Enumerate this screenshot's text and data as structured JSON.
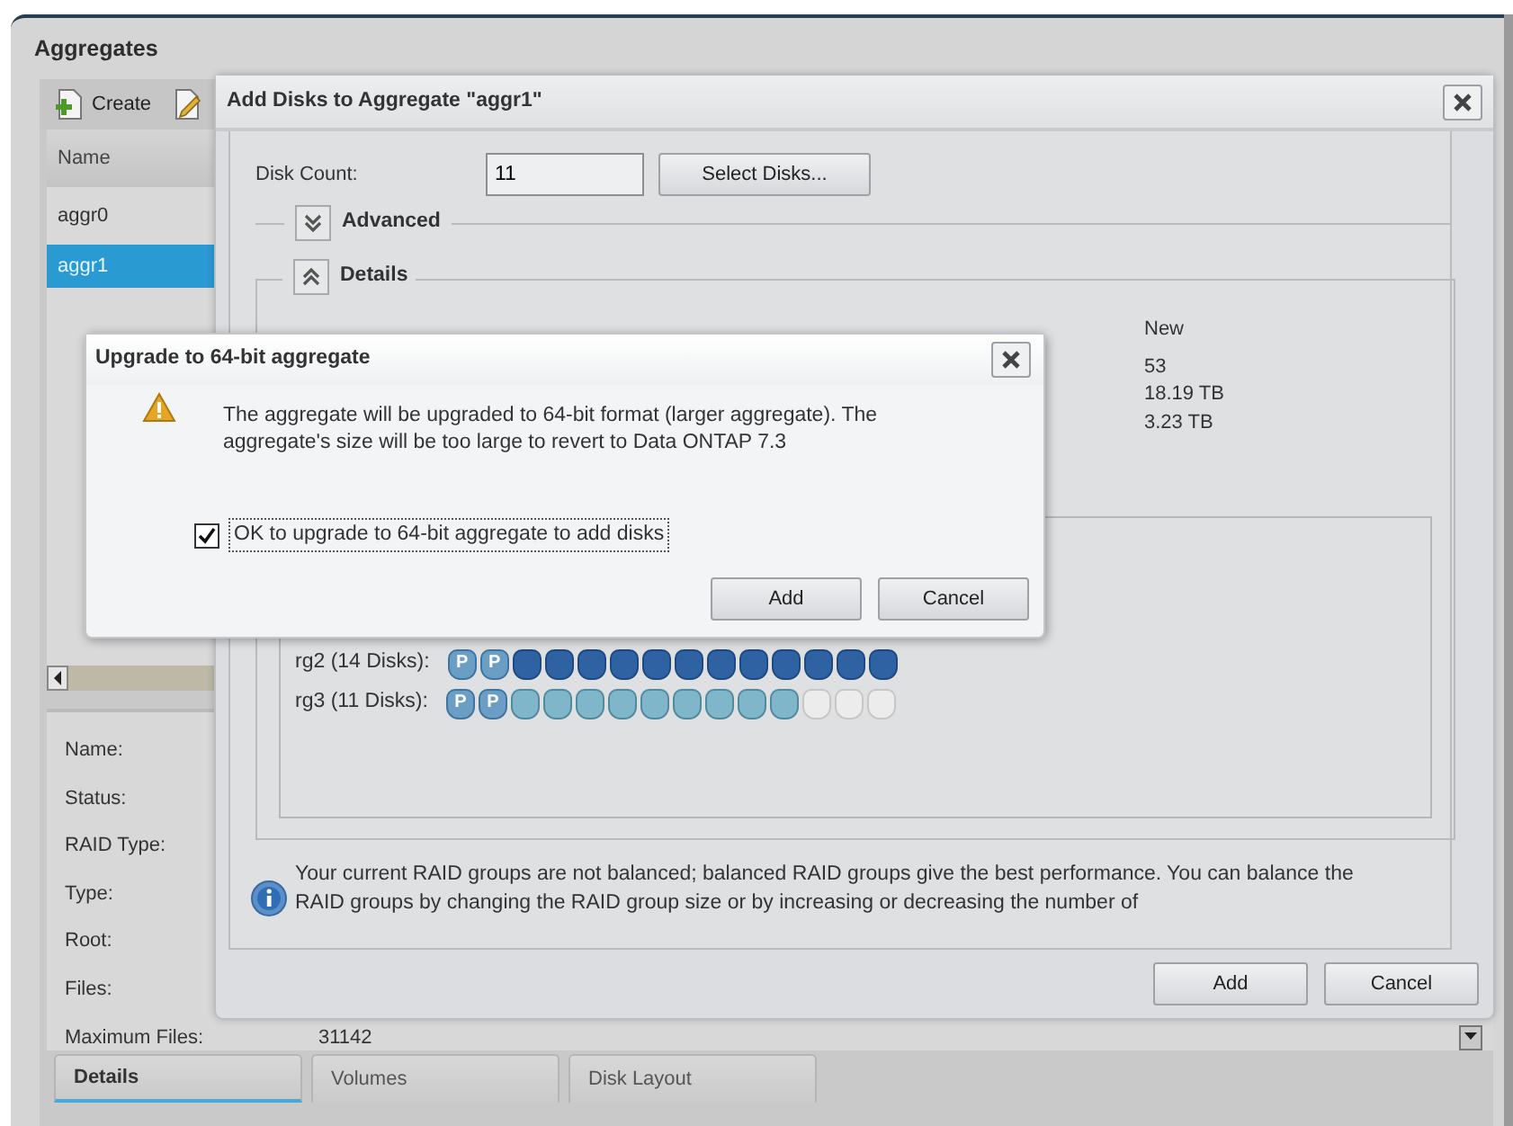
{
  "window": {
    "title": "Aggregates"
  },
  "toolbar": {
    "create_label": "Create"
  },
  "list": {
    "column": "Name",
    "rows": [
      {
        "name": "aggr0",
        "selected": false
      },
      {
        "name": "aggr1",
        "selected": true
      }
    ]
  },
  "details": [
    {
      "label": "Name:"
    },
    {
      "label": "Status:"
    },
    {
      "label": "RAID Type:"
    },
    {
      "label": "Type:"
    },
    {
      "label": "Root:"
    },
    {
      "label": "Files:"
    },
    {
      "label": "Maximum Files:",
      "value": "31142"
    }
  ],
  "tabs": [
    {
      "label": "Details",
      "selected": true
    },
    {
      "label": "Volumes",
      "selected": false
    },
    {
      "label": "Disk Layout",
      "selected": false
    }
  ],
  "add_disks_dialog": {
    "title": "Add Disks to Aggregate \"aggr1\"",
    "disk_count": {
      "label": "Disk Count:",
      "value": "11"
    },
    "select_button": "Select Disks...",
    "advanced": {
      "label": "Advanced",
      "expanded": false
    },
    "details_section": {
      "label": "Details",
      "expanded": true,
      "new_header": "New",
      "new_values": [
        "53",
        "18.19 TB",
        "3.23 TB"
      ]
    },
    "raid_groups": [
      {
        "label": "rg2 (14 Disks):",
        "disks": [
          {
            "kind": "parity",
            "label": "P"
          },
          {
            "kind": "parity",
            "label": "P"
          },
          {
            "kind": "data"
          },
          {
            "kind": "data"
          },
          {
            "kind": "data"
          },
          {
            "kind": "data"
          },
          {
            "kind": "data"
          },
          {
            "kind": "data"
          },
          {
            "kind": "data"
          },
          {
            "kind": "data"
          },
          {
            "kind": "data"
          },
          {
            "kind": "data"
          },
          {
            "kind": "data"
          },
          {
            "kind": "data"
          }
        ]
      },
      {
        "label": "rg3 (11 Disks):",
        "disks": [
          {
            "kind": "parity",
            "label": "P"
          },
          {
            "kind": "parity",
            "label": "P"
          },
          {
            "kind": "new"
          },
          {
            "kind": "new"
          },
          {
            "kind": "new"
          },
          {
            "kind": "new"
          },
          {
            "kind": "new"
          },
          {
            "kind": "new"
          },
          {
            "kind": "new"
          },
          {
            "kind": "new"
          },
          {
            "kind": "new"
          },
          {
            "kind": "empty"
          },
          {
            "kind": "empty"
          },
          {
            "kind": "empty"
          }
        ]
      }
    ],
    "info": "Your current RAID groups are not balanced; balanced RAID groups give the best performance. You can balance the RAID groups by changing the RAID group size or by increasing or decreasing the number of",
    "buttons": [
      "Add",
      "Cancel"
    ]
  },
  "upgrade_dialog": {
    "title": "Upgrade to 64-bit aggregate",
    "message": "The aggregate will be upgraded to 64-bit format (larger aggregate). The aggregate's size will be too large to revert to Data ONTAP 7.3",
    "checkbox": {
      "label": "OK to upgrade to 64-bit aggregate to add disks",
      "checked": true
    },
    "buttons": [
      "Add",
      "Cancel"
    ]
  }
}
